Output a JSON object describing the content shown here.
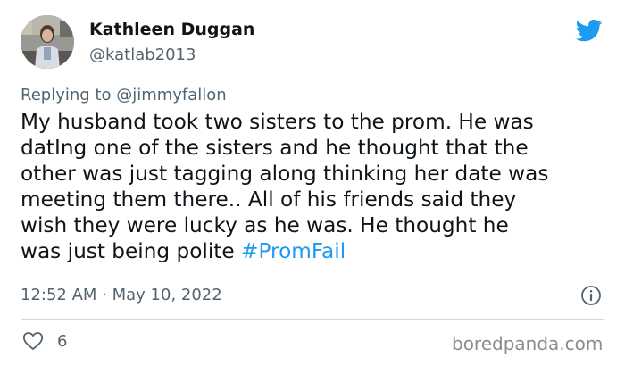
{
  "user": {
    "name": "Kathleen Duggan",
    "handle": "@katlab2013"
  },
  "reply": {
    "prefix": "Replying to ",
    "mention": "@jimmyfallon"
  },
  "tweet": {
    "lines": [
      "My husband took two sisters to the prom. He was",
      "datIng one of the sisters and he thought that the",
      "other was just tagging along thinking her date was",
      "meeting them there.. All of his friends said they",
      "wish they were lucky as he was. He thought he",
      "was just being polite "
    ],
    "hashtag": "#PromFail"
  },
  "meta": {
    "timestamp": "12:52 AM · May 10, 2022",
    "likes": "6"
  },
  "icons": {
    "brand": "twitter-bird-icon",
    "info": "info-icon",
    "like": "heart-icon"
  },
  "colors": {
    "twitter_blue": "#1d9bf0",
    "secondary_text": "#536471",
    "primary_text": "#0f1419"
  },
  "watermark": "boredpanda.com"
}
